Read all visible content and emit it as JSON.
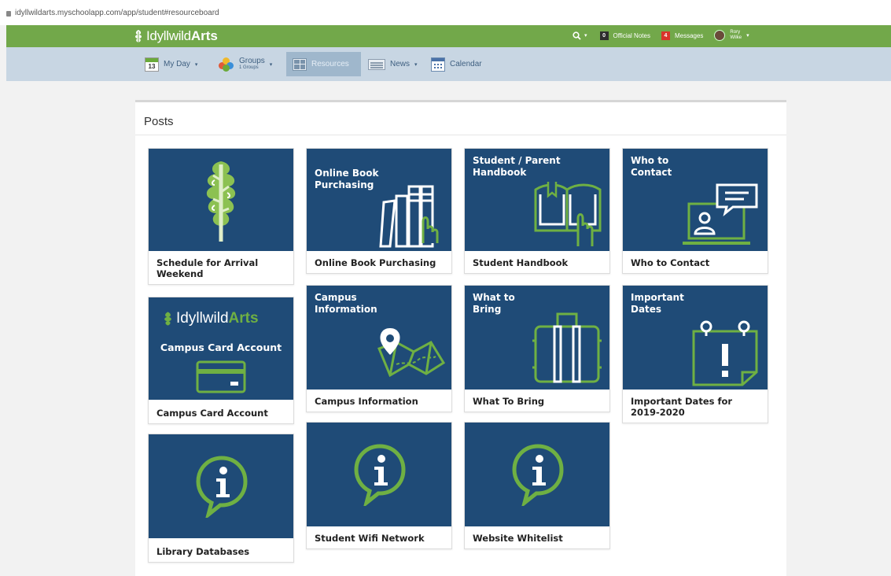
{
  "browser": {
    "url": "idyllwildarts.myschoolapp.com/app/student#resourceboard"
  },
  "header": {
    "logo_part1": "Idyllwild",
    "logo_part2": "Arts",
    "search_icon": "search-icon",
    "official_notes_count": "0",
    "official_notes_label": "Official Notes",
    "messages_count": "4",
    "messages_label": "Messages",
    "user_first": "Rory",
    "user_last": "Wilke",
    "accent_color": "#72a84a"
  },
  "subnav": {
    "calendar_day": "13",
    "my_day": "My Day",
    "groups": "Groups",
    "groups_count": "1 Groups",
    "resources": "Resources",
    "news": "News",
    "calendar": "Calendar"
  },
  "panel": {
    "title": "Posts"
  },
  "tiles": {
    "t1": {
      "tile_title": "",
      "caption": "Schedule for Arrival Weekend",
      "icon": "idyllwild-tree-icon"
    },
    "t2": {
      "tile_title": "Online Book\nPurchasing",
      "caption": "Online Book Purchasing",
      "icon": "books-icon"
    },
    "t3": {
      "tile_title": "Student / Parent\nHandbook",
      "caption": "Student Handbook",
      "icon": "open-book-icon"
    },
    "t4": {
      "tile_title": "Who to\nContact",
      "caption": "Who to Contact",
      "icon": "laptop-chat-icon"
    },
    "t5": {
      "logo1": "Idyllwild",
      "logo2": "Arts",
      "tile_title": "Campus Card Account",
      "caption": "Campus Card Account",
      "icon": "credit-card-icon"
    },
    "t6": {
      "tile_title": "Campus\nInformation",
      "caption": "Campus Information",
      "icon": "map-pin-icon"
    },
    "t7": {
      "tile_title": "What to\nBring",
      "caption": "What To Bring",
      "icon": "suitcase-icon"
    },
    "t8": {
      "tile_title": "Important\nDates",
      "caption": "Important Dates for 2019-2020",
      "icon": "calendar-alert-icon"
    },
    "t9": {
      "tile_title": "",
      "caption": "Library Databases",
      "icon": "info-bubble-icon"
    },
    "t10": {
      "tile_title": "",
      "caption": "Student Wifi Network",
      "icon": "info-bubble-icon"
    },
    "t11": {
      "tile_title": "",
      "caption": "Website Whitelist",
      "icon": "info-bubble-icon"
    }
  },
  "colors": {
    "tile_blue": "#1f4b77",
    "icon_green": "#6fb043",
    "subnav_bg": "#c8d6e3"
  }
}
